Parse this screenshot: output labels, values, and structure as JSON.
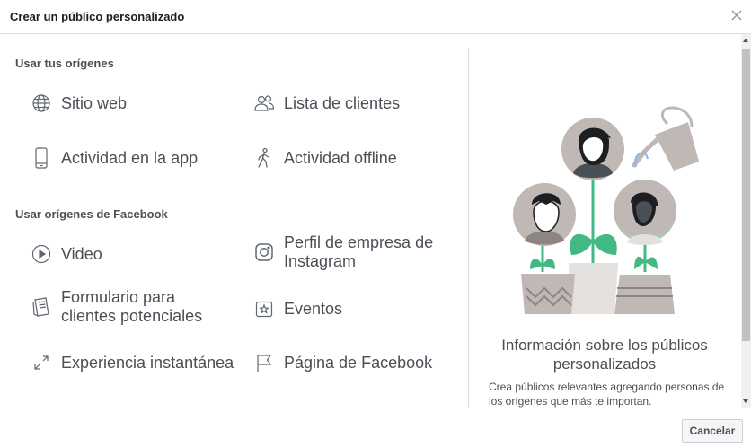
{
  "dialog": {
    "title": "Crear un público personalizado",
    "close_icon": "close-icon"
  },
  "sources": {
    "own_heading": "Usar tus orígenes",
    "own_items": [
      {
        "label": "Sitio web",
        "icon": "globe-icon"
      },
      {
        "label": "Lista de clientes",
        "icon": "people-icon"
      },
      {
        "label": "Actividad en la app",
        "icon": "mobile-icon"
      },
      {
        "label": "Actividad offline",
        "icon": "walking-person-icon"
      }
    ],
    "facebook_heading": "Usar orígenes de Facebook",
    "facebook_items": [
      {
        "label": "Video",
        "icon": "play-icon"
      },
      {
        "label": "Perfil de empresa de Instagram",
        "icon": "instagram-icon"
      },
      {
        "label": "Formulario para clientes potenciales",
        "icon": "form-icon"
      },
      {
        "label": "Eventos",
        "icon": "event-star-icon"
      },
      {
        "label": "Experiencia instantánea",
        "icon": "expand-icon"
      },
      {
        "label": "Página de Facebook",
        "icon": "flag-icon"
      }
    ]
  },
  "info": {
    "title": "Información sobre los públicos personalizados",
    "text": "Crea públicos relevantes agregando personas de los orígenes que más te importan."
  },
  "footer": {
    "cancel_label": "Cancelar"
  },
  "colors": {
    "text": "#4b4f56",
    "border": "#dadde1",
    "plant_green": "#42b883",
    "pot": "#bfb8b4"
  }
}
